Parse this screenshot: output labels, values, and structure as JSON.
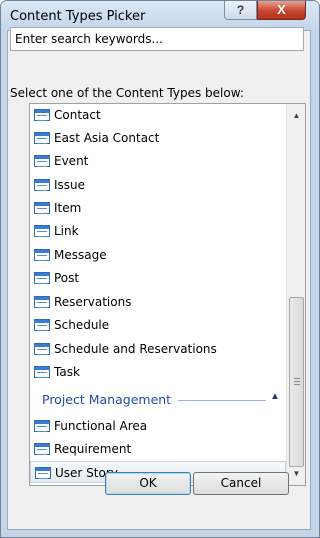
{
  "window": {
    "title": "Content Types Picker"
  },
  "titlebar": {
    "help_label": "?",
    "close_label": "X"
  },
  "search": {
    "placeholder": "Enter search keywords..."
  },
  "prompt": "Select one of the Content Types below:",
  "list": {
    "items": [
      "Contact",
      "East Asia Contact",
      "Event",
      "Issue",
      "Item",
      "Link",
      "Message",
      "Post",
      "Reservations",
      "Schedule",
      "Schedule and Reservations",
      "Task"
    ],
    "group": {
      "label": "Project Management",
      "items": [
        "Functional Area",
        "Requirement",
        "User Story"
      ]
    },
    "selected": "User Story"
  },
  "buttons": {
    "ok": "OK",
    "cancel": "Cancel"
  },
  "colors": {
    "title_bar": "#c3d5ea",
    "close": "#c7452d",
    "group_label": "#1e4da8",
    "accent": "#3a7bd5"
  }
}
